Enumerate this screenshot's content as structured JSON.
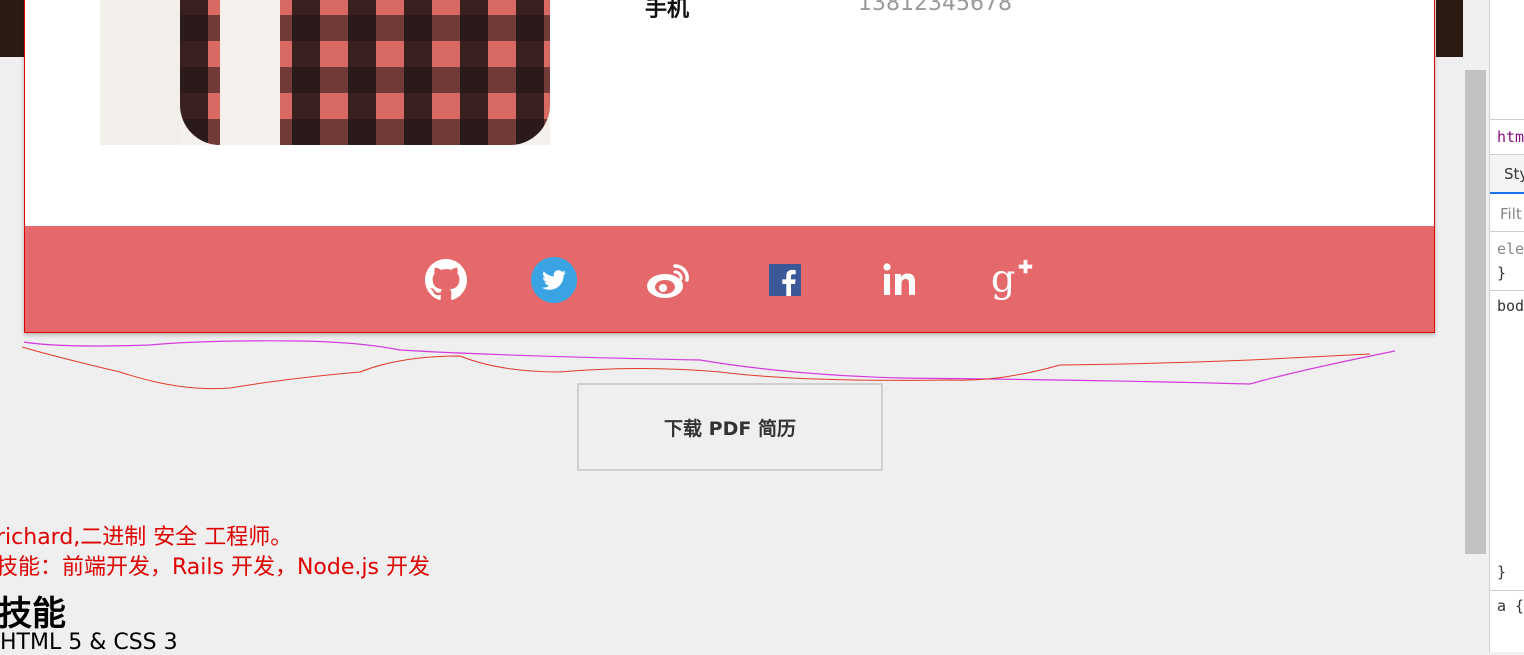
{
  "profile": {
    "phone_label": "手机",
    "phone_value": "13812345678"
  },
  "social": {
    "bar_color": "#e5696a",
    "icons": [
      "github-icon",
      "twitter-icon",
      "weibo-icon",
      "facebook-icon",
      "linkedin-icon",
      "google-plus-icon"
    ]
  },
  "download": {
    "label": "下载 PDF 简历"
  },
  "intro": {
    "line1": "richard,二进制 安全 工程师。",
    "line2": "技能：前端开发，Rails 开发，Node.js 开发"
  },
  "skills": {
    "heading": "技能",
    "first_item": "HTML 5 & CSS 3"
  },
  "devtools": {
    "breadcrumb": "htm",
    "tab": "Sty",
    "filter_placeholder": "Filt",
    "rule1_selector": "ele",
    "rule1_close": "}",
    "rule2_selector": "bod",
    "rule2_close": "}",
    "rule3_selector": "a {"
  },
  "colors": {
    "accent_red": "#e00000",
    "page_bg": "#efefef"
  }
}
